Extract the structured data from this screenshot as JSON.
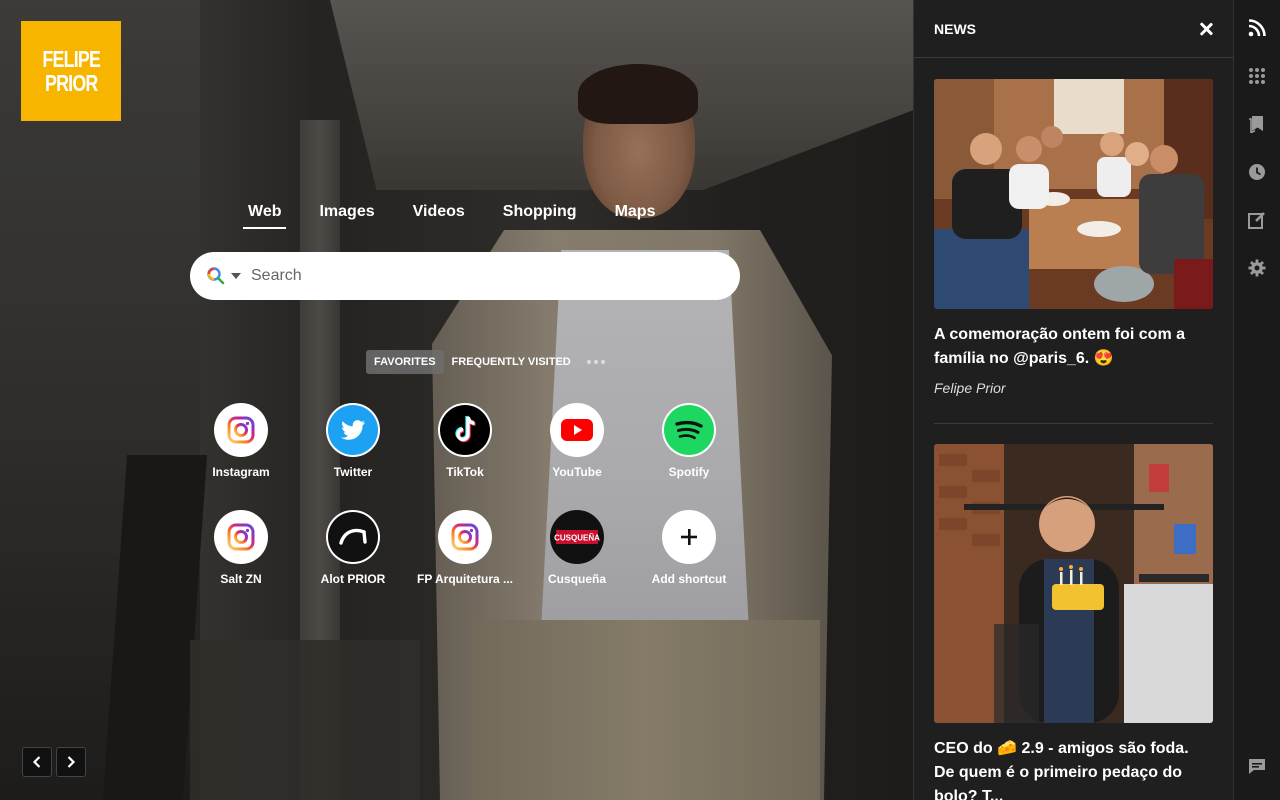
{
  "brand": {
    "logo_line1": "FELIPE",
    "logo_line2": "PRIOR",
    "logo_color": "#f7b500"
  },
  "search": {
    "tabs": [
      {
        "label": "Web",
        "active": true
      },
      {
        "label": "Images",
        "active": false
      },
      {
        "label": "Videos",
        "active": false
      },
      {
        "label": "Shopping",
        "active": false
      },
      {
        "label": "Maps",
        "active": false
      }
    ],
    "placeholder": "Search"
  },
  "shortcuts_tabs": {
    "favorites": "FAVORITES",
    "frequently_visited": "FREQUENTLY VISITED",
    "active": "favorites"
  },
  "shortcuts": [
    {
      "label": "Instagram",
      "icon": "instagram-icon"
    },
    {
      "label": "Twitter",
      "icon": "twitter-icon"
    },
    {
      "label": "TikTok",
      "icon": "tiktok-icon"
    },
    {
      "label": "YouTube",
      "icon": "youtube-icon"
    },
    {
      "label": "Spotify",
      "icon": "spotify-icon"
    },
    {
      "label": "Salt ZN",
      "icon": "instagram-icon"
    },
    {
      "label": "Alot PRIOR",
      "icon": "alot-icon"
    },
    {
      "label": "FP Arquitetura ...",
      "icon": "instagram-icon"
    },
    {
      "label": "Cusqueña",
      "icon": "cusquena-icon"
    },
    {
      "label": "Add shortcut",
      "icon": "plus-icon"
    }
  ],
  "cusquena_logo_text": "CUSQUEÑA",
  "news": {
    "title": "NEWS",
    "items": [
      {
        "headline": "A comemoração ontem foi com a família no @paris_6. 😍",
        "author": "Felipe Prior"
      },
      {
        "headline": "CEO do 🧀 2.9 - amigos são foda. De quem é o primeiro pedaço do bolo? T...",
        "author": ""
      }
    ]
  },
  "toolbar": [
    "rss-icon",
    "apps-grid-icon",
    "bookmarks-icon",
    "history-icon",
    "notes-icon",
    "settings-icon",
    "feedback-icon"
  ]
}
